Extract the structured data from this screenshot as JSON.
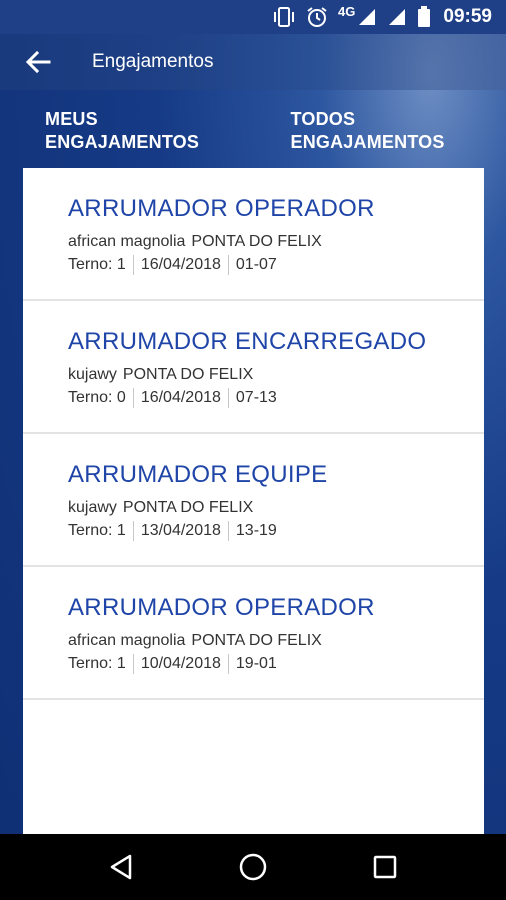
{
  "status_bar": {
    "network_type": "4G",
    "time": "09:59",
    "icons": [
      "vibrate-icon",
      "alarm-icon",
      "signal-icon",
      "signal-icon",
      "battery-icon"
    ]
  },
  "app_bar": {
    "title": "Engajamentos",
    "back_icon": "arrow-back-icon"
  },
  "tabs": [
    {
      "line1": "MEUS",
      "line2": "ENGAJAMENTOS"
    },
    {
      "line1": "TODOS",
      "line2": "ENGAJAMENTOS"
    }
  ],
  "items": [
    {
      "title": "ARRUMADOR OPERADOR",
      "vessel": "african magnolia",
      "location": "PONTA DO FELIX",
      "terno": "Terno: 1",
      "date": "16/04/2018",
      "shift": "01-07"
    },
    {
      "title": "ARRUMADOR ENCARREGADO",
      "vessel": "kujawy",
      "location": "PONTA DO FELIX",
      "terno": "Terno: 0",
      "date": "16/04/2018",
      "shift": "07-13"
    },
    {
      "title": "ARRUMADOR EQUIPE",
      "vessel": "kujawy",
      "location": "PONTA DO FELIX",
      "terno": "Terno: 1",
      "date": "13/04/2018",
      "shift": "13-19"
    },
    {
      "title": "ARRUMADOR OPERADOR",
      "vessel": "african magnolia",
      "location": "PONTA DO FELIX",
      "terno": "Terno: 1",
      "date": "10/04/2018",
      "shift": "19-01"
    }
  ],
  "nav_bar": {
    "icons": [
      "back-triangle-icon",
      "home-circle-icon",
      "recents-square-icon"
    ]
  },
  "colors": {
    "accent_title": "#1f45a8",
    "app_background": "#163a86",
    "nav_background": "#000000"
  }
}
